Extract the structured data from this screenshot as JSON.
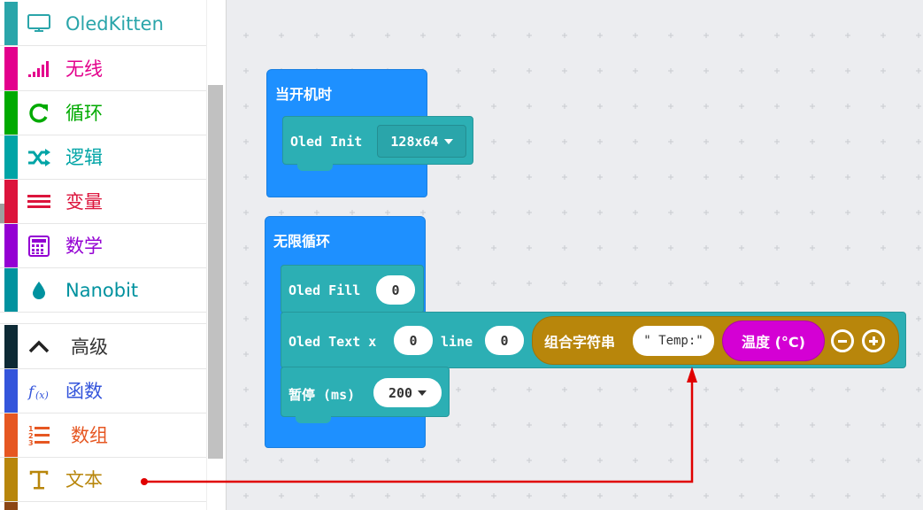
{
  "toolbox": {
    "categories": [
      {
        "label": "OledKitten",
        "color": "#2aa5aa",
        "icon": "monitor-icon"
      },
      {
        "label": "无线",
        "color": "#e3008c",
        "icon": "signal-bars-icon"
      },
      {
        "label": "循环",
        "color": "#00aa00",
        "icon": "refresh-icon"
      },
      {
        "label": "逻辑",
        "color": "#00a4a6",
        "icon": "shuffle-icon"
      },
      {
        "label": "变量",
        "color": "#dc143c",
        "icon": "list-lines-icon"
      },
      {
        "label": "数学",
        "color": "#9400d3",
        "icon": "calculator-icon"
      },
      {
        "label": "Nanobit",
        "color": "#00929f",
        "icon": "water-drop-icon"
      },
      {
        "label": "高级",
        "color": "#333333",
        "icon": "chevron-up-icon"
      },
      {
        "label": "函数",
        "color": "#3455db",
        "icon": "function-icon"
      },
      {
        "label": "数组",
        "color": "#e65722",
        "icon": "numbered-list-icon"
      },
      {
        "label": "文本",
        "color": "#b8860b",
        "icon": "text-icon"
      }
    ]
  },
  "workspace": {
    "on_start": {
      "title": "当开机时",
      "oled_init_label": "Oled Init",
      "oled_init_value": "128x64"
    },
    "forever": {
      "title": "无限循环",
      "oled_fill_label": "Oled Fill",
      "oled_fill_value": "0",
      "oled_text_label": "Oled Text x",
      "oled_text_x": "0",
      "oled_text_line_label": "line",
      "oled_text_line": "0",
      "join_label": "组合字符串",
      "join_text": "\" Temp:\"",
      "temperature_label": "温度 (°C)",
      "pause_label": "暂停 (ms)",
      "pause_value": "200"
    }
  },
  "annotation": {
    "arrow_color": "#e00000"
  }
}
